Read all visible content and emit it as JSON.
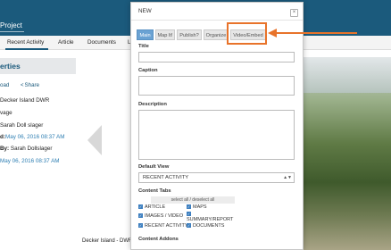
{
  "app": {
    "project_title": "Project",
    "nav": [
      "Recent Activity",
      "Article",
      "Documents",
      "L"
    ]
  },
  "left_panel": {
    "title": "erties",
    "download_label": "oad",
    "share_label": "Share",
    "rows": [
      {
        "label": "",
        "value": "Decker Island DWR"
      },
      {
        "label": "",
        "value": "vage"
      },
      {
        "label": "",
        "value": "Sarah Doll slager"
      },
      {
        "label": "d:",
        "value": "May 06, 2016 08:37 AM"
      },
      {
        "label": "By:",
        "value": "Sarah Dollslager"
      },
      {
        "label": "",
        "value": "May 06, 2016 08:37 AM"
      }
    ]
  },
  "photo_caption": "Decker Island - DWR",
  "modal": {
    "title": "NEW",
    "close_glyph": "×",
    "tabs": [
      {
        "label": "Main",
        "active": true
      },
      {
        "label": "Map It!",
        "active": false
      },
      {
        "label": "Publish?",
        "active": false
      },
      {
        "label": "Organize",
        "active": false
      },
      {
        "label": "Video/Embed",
        "active": false
      }
    ],
    "fields": {
      "title_label": "Title",
      "title_value": "",
      "caption_label": "Caption",
      "caption_value": "",
      "description_label": "Description",
      "description_value": ""
    },
    "default_view": {
      "label": "Default View",
      "value": "RECENT ACTIVITY"
    },
    "content_tabs": {
      "label": "Content Tabs",
      "select_all": "select all / deselect all",
      "items": [
        {
          "label": "ARTICLE",
          "checked": true
        },
        {
          "label": "MAPS",
          "checked": true
        },
        {
          "label": "IMAGES / VIDEO",
          "checked": true
        },
        {
          "label": "SUMMARY/REPORT",
          "checked": true
        },
        {
          "label": "RECENT ACTIVITY",
          "checked": true
        },
        {
          "label": "DOCUMENTS",
          "checked": true
        }
      ]
    },
    "content_addons_label": "Content Addons"
  },
  "colors": {
    "header_blue": "#1b5a7c",
    "active_tab": "#6aa2d3",
    "annotation_orange": "#e8732a"
  }
}
